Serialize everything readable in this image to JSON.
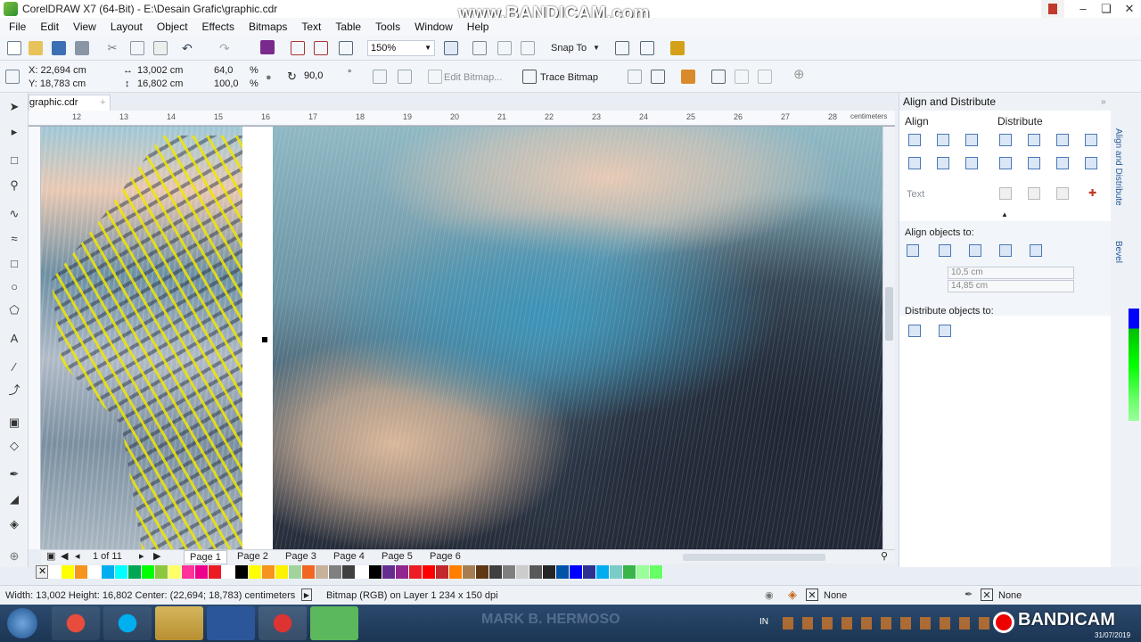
{
  "window": {
    "title": "CorelDRAW X7 (64-Bit) - E:\\Desain Grafic\\graphic.cdr",
    "watermark": "www.BANDICAM.com"
  },
  "menu": [
    "File",
    "Edit",
    "View",
    "Layout",
    "Object",
    "Effects",
    "Bitmaps",
    "Text",
    "Table",
    "Tools",
    "Window",
    "Help"
  ],
  "standard_toolbar": {
    "zoom_level": "150%",
    "snap_to_label": "Snap To"
  },
  "property_bar": {
    "x": "X: 22,694 cm",
    "y": "Y: 18,783 cm",
    "width": "13,002 cm",
    "height": "16,802 cm",
    "scale_w": "64,0",
    "scale_h": "100,0",
    "pct1": "%",
    "pct2": "%",
    "rotation": "90,0",
    "degree": "°",
    "edit_bitmap": "Edit Bitmap...",
    "trace_bitmap": "Trace Bitmap"
  },
  "document_tab": "graphic.cdr",
  "ruler": {
    "ticks": [
      "12",
      "13",
      "14",
      "15",
      "16",
      "17",
      "18",
      "19",
      "20",
      "21",
      "22",
      "23",
      "24",
      "25",
      "26",
      "27",
      "28"
    ],
    "unit": "centimeters"
  },
  "pages": {
    "counter": "1 of 11",
    "tabs": [
      "Page 1",
      "Page 2",
      "Page 3",
      "Page 4",
      "Page 5",
      "Page 6"
    ]
  },
  "palette_colors": [
    "#ffffff",
    "#ffff00",
    "#f7941d",
    "#ffffff",
    "#00aeef",
    "#00ffff",
    "#00a651",
    "#00ff00",
    "#8dc63f",
    "#ffff66",
    "#ff3399",
    "#ec008c",
    "#ed1c24",
    "#ffffff",
    "#000000",
    "#ffff00",
    "#f7941d",
    "#fff200",
    "#a3d39c",
    "#f26522",
    "#c7b299",
    "#808080",
    "#404040",
    "#ffffff",
    "#000000",
    "#662d91",
    "#92278f",
    "#ed1c24",
    "#ff0000",
    "#c1272d",
    "#ff7f00",
    "#a67c52",
    "#603913",
    "#404040",
    "#7f7f7f",
    "#cccccc",
    "#595959",
    "#262626",
    "#0054a6",
    "#0000ff",
    "#2e3192",
    "#00aeef",
    "#7accc8",
    "#39b54a",
    "#99ff99",
    "#66ff66"
  ],
  "status": {
    "dimensions": "Width: 13,002  Height: 16,802  Center: (22,694; 18,783)  centimeters",
    "object_info": "Bitmap (RGB) on Layer 1 234 x 150 dpi",
    "fill": "None",
    "outline": "None"
  },
  "docker": {
    "title": "Align and Distribute",
    "align_label": "Align",
    "distribute_label": "Distribute",
    "text_label": "Text",
    "align_objects_to": "Align objects to:",
    "field_x": "10,5 cm",
    "field_y": "14,85 cm",
    "distribute_objects_to": "Distribute objects to:",
    "side_tabs": [
      "Align and Distribute",
      "Bevel"
    ]
  },
  "taskbar": {
    "lang": "IN",
    "recorder": "BANDICAM",
    "date": "31/07/2019",
    "wallpaper_text": "MARK B. HERMOSO"
  }
}
